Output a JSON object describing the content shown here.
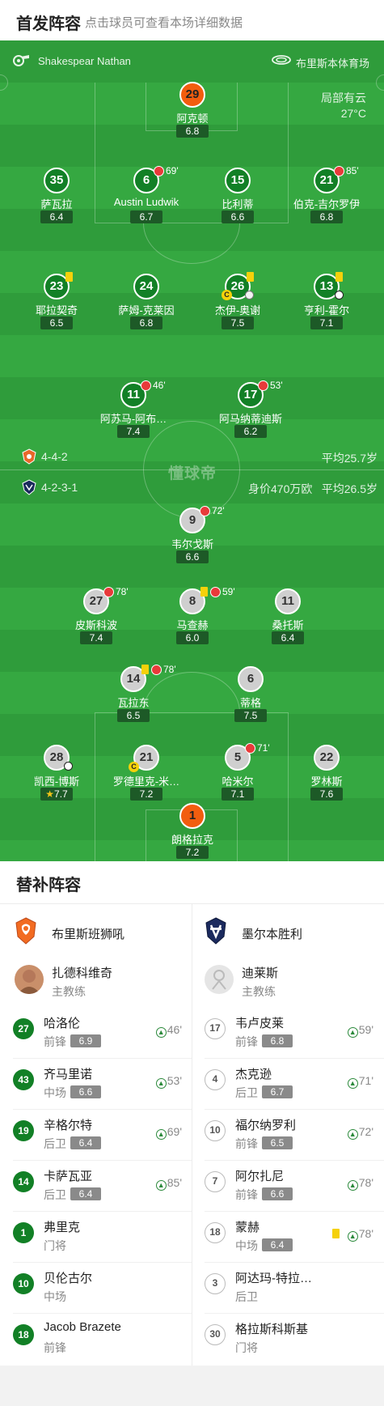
{
  "header": {
    "title": "首发阵容",
    "subtitle": "点击球员可查看本场详细数据"
  },
  "info": {
    "referee": "Shakespear Nathan",
    "venue": "布里斯本体育场",
    "weather": "局部有云",
    "temperature": "27°C"
  },
  "center_logo": "懂球帝",
  "home": {
    "formation": "4-4-2",
    "avg_age": "平均25.7岁",
    "players": [
      {
        "num": "29",
        "name": "阿克顿",
        "rating": "6.8"
      },
      {
        "num": "35",
        "name": "萨瓦拉",
        "rating": "6.4"
      },
      {
        "num": "6",
        "name": "Austin Ludwik",
        "rating": "6.7",
        "sub_min": "69'"
      },
      {
        "num": "15",
        "name": "比利蒂",
        "rating": "6.6"
      },
      {
        "num": "21",
        "name": "伯克-吉尔罗伊",
        "rating": "6.8",
        "sub_min": "85'"
      },
      {
        "num": "23",
        "name": "耶拉契奇",
        "rating": "6.5"
      },
      {
        "num": "24",
        "name": "萨姆-克莱因",
        "rating": "6.8"
      },
      {
        "num": "26",
        "name": "杰伊-奥谢",
        "rating": "7.5"
      },
      {
        "num": "13",
        "name": "亨利-霍尔",
        "rating": "7.1"
      },
      {
        "num": "11",
        "name": "阿苏马-阿布…",
        "rating": "7.4",
        "sub_min": "46'"
      },
      {
        "num": "17",
        "name": "阿马纳蒂迪斯",
        "rating": "6.2",
        "sub_min": "53'"
      }
    ]
  },
  "away": {
    "formation": "4-2-3-1",
    "value": "身价470万欧",
    "avg_age": "平均26.5岁",
    "players": [
      {
        "num": "9",
        "name": "韦尔戈斯",
        "rating": "6.6",
        "sub_min": "72'"
      },
      {
        "num": "27",
        "name": "皮斯科波",
        "rating": "7.4",
        "sub_min": "78'"
      },
      {
        "num": "8",
        "name": "马查赫",
        "rating": "6.0",
        "sub_min": "59'"
      },
      {
        "num": "11",
        "name": "桑托斯",
        "rating": "6.4"
      },
      {
        "num": "14",
        "name": "瓦拉东",
        "rating": "6.5",
        "sub_min": "78'"
      },
      {
        "num": "6",
        "name": "蒂格",
        "rating": "7.5"
      },
      {
        "num": "28",
        "name": "凯西-博斯",
        "rating": "7.7"
      },
      {
        "num": "21",
        "name": "罗德里克-米…",
        "rating": "7.2"
      },
      {
        "num": "5",
        "name": "哈米尔",
        "rating": "7.1",
        "sub_min": "71'"
      },
      {
        "num": "22",
        "name": "罗林斯",
        "rating": "7.6"
      },
      {
        "num": "1",
        "name": "朗格拉克",
        "rating": "7.2"
      }
    ]
  },
  "subs": {
    "title": "替补阵容",
    "home": {
      "team": "布里斯班狮吼",
      "coach": {
        "name": "扎德科维奇",
        "role": "主教练"
      },
      "players": [
        {
          "num": "27",
          "name": "哈洛伦",
          "pos": "前锋",
          "rating": "6.9",
          "in": "46'"
        },
        {
          "num": "43",
          "name": "齐马里诺",
          "pos": "中场",
          "rating": "6.6",
          "in": "53'"
        },
        {
          "num": "19",
          "name": "辛格尔特",
          "pos": "后卫",
          "rating": "6.4",
          "in": "69'"
        },
        {
          "num": "14",
          "name": "卡萨瓦亚",
          "pos": "后卫",
          "rating": "6.4",
          "in": "85'"
        },
        {
          "num": "1",
          "name": "弗里克",
          "pos": "门将"
        },
        {
          "num": "10",
          "name": "贝伦古尔",
          "pos": "中场"
        },
        {
          "num": "18",
          "name": "Jacob Brazete",
          "pos": "前锋"
        }
      ]
    },
    "away": {
      "team": "墨尔本胜利",
      "coach": {
        "name": "迪莱斯",
        "role": "主教练"
      },
      "players": [
        {
          "num": "17",
          "name": "韦卢皮莱",
          "pos": "前锋",
          "rating": "6.8",
          "in": "59'"
        },
        {
          "num": "4",
          "name": "杰克逊",
          "pos": "后卫",
          "rating": "6.7",
          "in": "71'"
        },
        {
          "num": "10",
          "name": "福尔纳罗利",
          "pos": "前锋",
          "rating": "6.5",
          "in": "72'"
        },
        {
          "num": "7",
          "name": "阿尔扎尼",
          "pos": "前锋",
          "rating": "6.6",
          "in": "78'"
        },
        {
          "num": "18",
          "name": "蒙赫",
          "pos": "中场",
          "rating": "6.4",
          "in": "78'"
        },
        {
          "num": "3",
          "name": "阿达玛-特拉…",
          "pos": "后卫"
        },
        {
          "num": "30",
          "name": "格拉斯科斯基",
          "pos": "门将"
        }
      ]
    }
  },
  "colors": {
    "pitch": "#35a841",
    "home_badge": "#128026",
    "gk": "#f25d0f",
    "away_badge": "#cfcfcf"
  }
}
